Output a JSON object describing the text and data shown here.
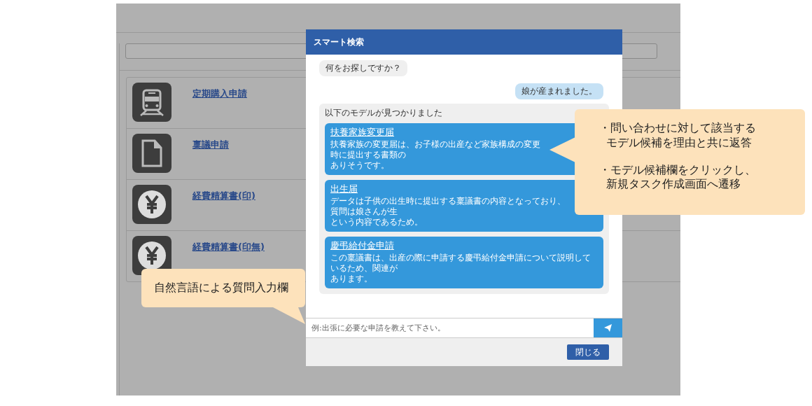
{
  "background_list": {
    "items": [
      {
        "kind": "train",
        "label": "定期購入申請"
      },
      {
        "kind": "document",
        "label": "稟議申請"
      },
      {
        "kind": "yen",
        "label": "経費精算書(印)"
      },
      {
        "kind": "yen",
        "label": "経費精算書(印無)"
      }
    ]
  },
  "modal": {
    "title": "スマート検索",
    "messages": [
      {
        "kind": "bot",
        "text": "何をお探しですか？"
      },
      {
        "kind": "user",
        "text": "娘が産まれました。"
      }
    ],
    "results": {
      "heading": "以下のモデルが見つかりました",
      "items": [
        {
          "title": "扶養家族変更届",
          "description_lines": [
            "扶養家族の変更届は、お子様の出産など家族構成の変更時に提出する書類の",
            "ありそうです。"
          ]
        },
        {
          "title": "出生届",
          "description_lines": [
            "データは子供の出生時に提出する稟議書の内容となっており、質問は娘さんが生",
            "という内容であるため。"
          ]
        },
        {
          "title": "慶弔給付金申請",
          "description_lines": [
            "この稟議書は、出産の際に申請する慶弔給付金申請について説明しているため、関連が",
            "あります。"
          ]
        }
      ]
    },
    "input": {
      "placeholder": "例:出張に必要な申請を教えて下さい。"
    },
    "close_button": "閉じる"
  },
  "callouts": [
    {
      "kind": "right",
      "paragraphs": [
        [
          "・問い合わせに対して該当する",
          "モデル候補を理由と共に返答"
        ],
        [
          "・モデル候補欄をクリックし、",
          "新規タスク作成画面へ遷移"
        ]
      ]
    },
    {
      "kind": "below",
      "paragraphs": [
        [
          "自然言語による質問入力欄"
        ]
      ]
    }
  ]
}
